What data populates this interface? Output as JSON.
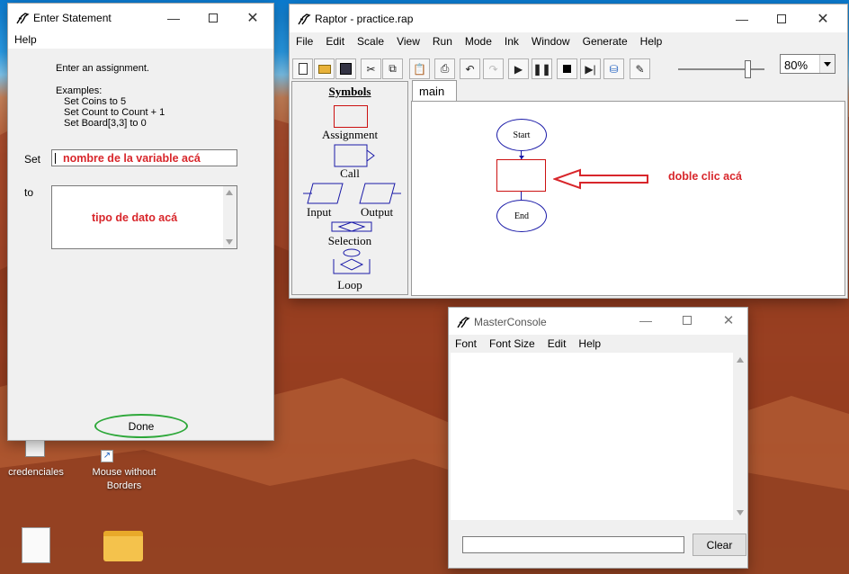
{
  "desktop": {
    "icons": [
      {
        "label": "credenciales"
      },
      {
        "label": "Mouse without Borders"
      }
    ]
  },
  "enter_statement": {
    "title": "Enter Statement",
    "menu": [
      "Help"
    ],
    "instruction": "Enter an assignment.",
    "examples_label": "Examples:",
    "examples": [
      "Set Coins to 5",
      "Set Count to Count + 1",
      "Set Board[3,3] to 0"
    ],
    "set_label": "Set",
    "to_label": "to",
    "set_annotation": "nombre de la variable acá",
    "to_annotation": "tipo de dato acá",
    "done_label": "Done"
  },
  "raptor": {
    "title": "Raptor - practice.rap",
    "menu": [
      "File",
      "Edit",
      "Scale",
      "View",
      "Run",
      "Mode",
      "Ink",
      "Window",
      "Generate",
      "Help"
    ],
    "zoom": "80%",
    "zoom_level": 0.85,
    "symbols_header": "Symbols",
    "symbols": {
      "assignment": "Assignment",
      "call": "Call",
      "input": "Input",
      "output": "Output",
      "selection": "Selection",
      "loop": "Loop"
    },
    "tab": "main",
    "flow": {
      "start": "Start",
      "end": "End"
    },
    "annotation": "doble clic acá",
    "colors": {
      "annotation_red": "#d8262b",
      "flow_blue": "#1a1aa8",
      "assign_red": "#cc1111"
    }
  },
  "console": {
    "title": "MasterConsole",
    "menu": [
      "Font",
      "Font Size",
      "Edit",
      "Help"
    ],
    "clear_label": "Clear"
  }
}
